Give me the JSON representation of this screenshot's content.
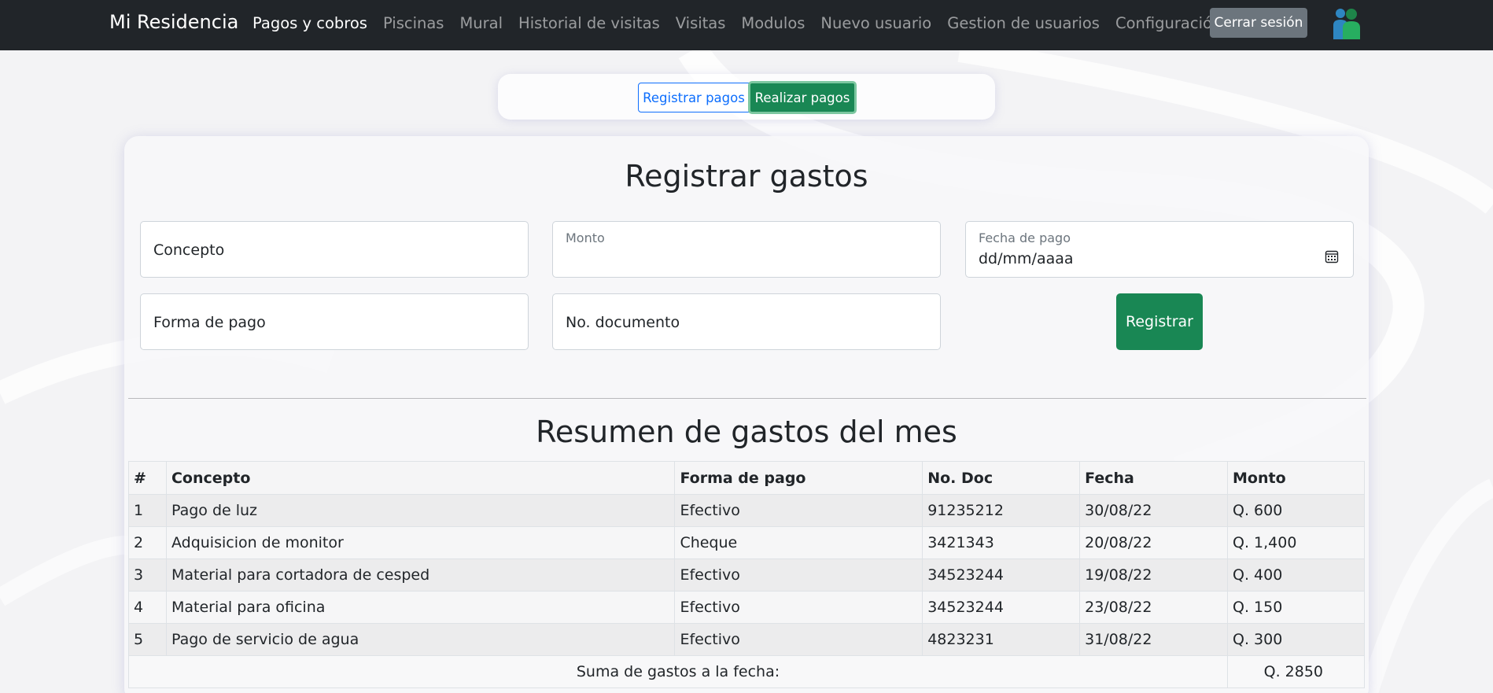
{
  "navbar": {
    "brand": "Mi Residencia",
    "links": [
      "Pagos y cobros",
      "Piscinas",
      "Mural",
      "Historial de visitas",
      "Visitas",
      "Modulos",
      "Nuevo usuario",
      "Gestion de usuarios",
      "Configuración"
    ],
    "active_index": 0,
    "logout_label": "Cerrar sesión",
    "avatar_icon": "user-group-icon"
  },
  "toggle": {
    "register_label": "Registrar pagos",
    "make_label": "Realizar pagos"
  },
  "form": {
    "title": "Registrar gastos",
    "concepto_placeholder": "Concepto",
    "monto_label": "Monto",
    "fecha_label": "Fecha de pago",
    "fecha_value": "dd/mm/aaaa",
    "forma_placeholder": "Forma de pago",
    "documento_placeholder": "No. documento",
    "submit_label": "Registrar"
  },
  "summary": {
    "title": "Resumen de gastos del mes",
    "headers": [
      "#",
      "Concepto",
      "Forma de pago",
      "No. Doc",
      "Fecha",
      "Monto"
    ],
    "rows": [
      [
        "1",
        "Pago de luz",
        "Efectivo",
        "91235212",
        "30/08/22",
        "Q. 600"
      ],
      [
        "2",
        "Adquisicion de monitor",
        "Cheque",
        "3421343",
        "20/08/22",
        "Q. 1,400"
      ],
      [
        "3",
        "Material para cortadora de cesped",
        "Efectivo",
        "34523244",
        "19/08/22",
        "Q. 400"
      ],
      [
        "4",
        "Material para oficina",
        "Efectivo",
        "34523244",
        "23/08/22",
        "Q. 150"
      ],
      [
        "5",
        "Pago de servicio de agua",
        "Efectivo",
        "4823231",
        "31/08/22",
        "Q. 300"
      ]
    ],
    "total_label": "Suma de gastos a la fecha:",
    "total_value": "Q. 2850"
  },
  "colors": {
    "navbar": "#212529",
    "success": "#198754",
    "primary": "#0d6efd",
    "secondary": "#6c757d"
  }
}
